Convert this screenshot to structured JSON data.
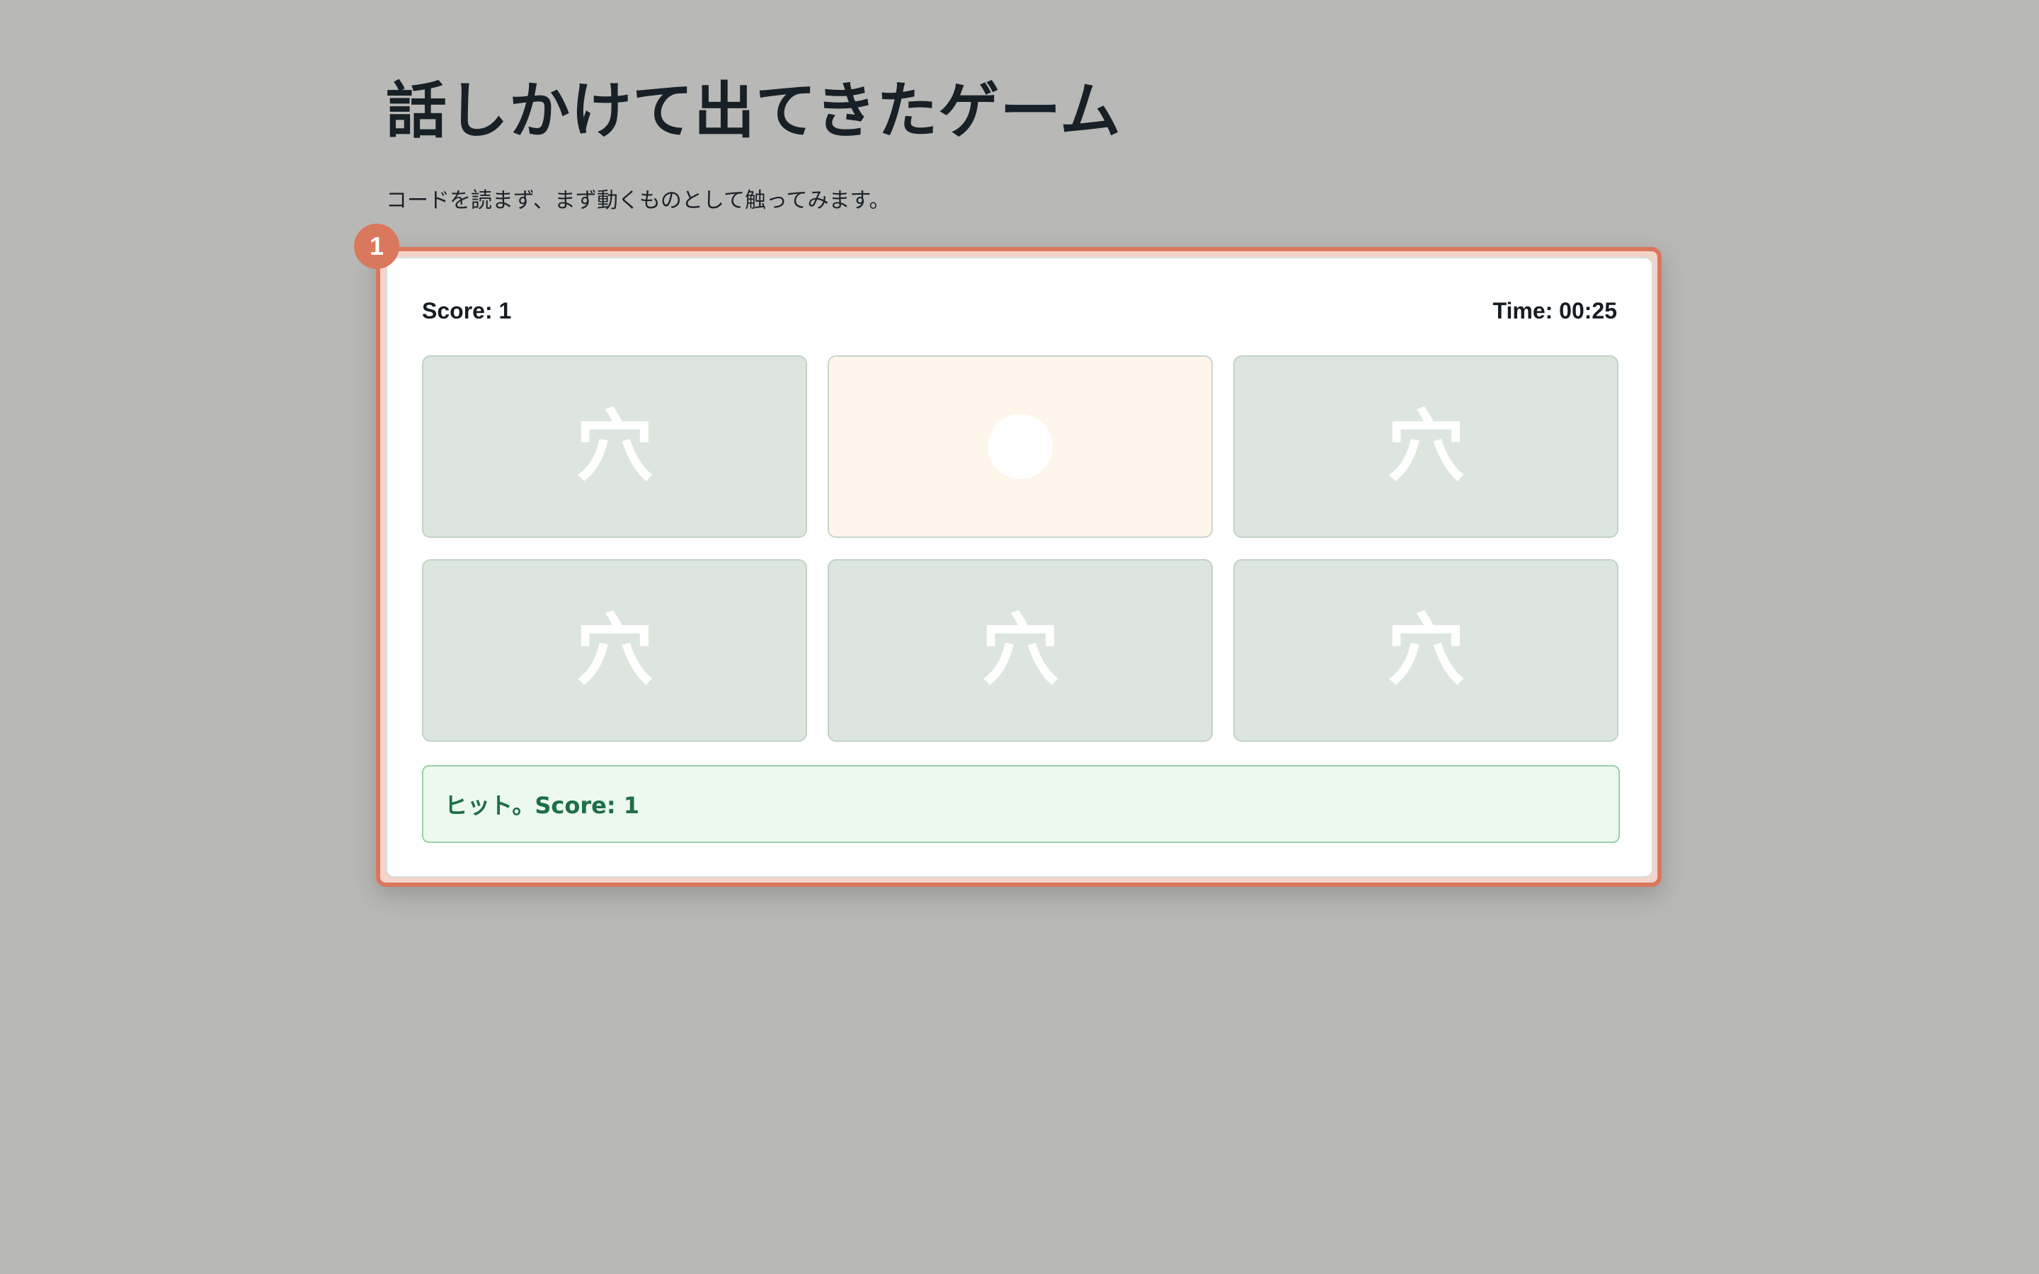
{
  "page": {
    "title": "話しかけて出てきたゲーム",
    "subtitle": "コードを読まず、まず動くものとして触ってみます。"
  },
  "annotation": {
    "badge": "1",
    "color": "#d9785c"
  },
  "game": {
    "score_text": "Score: 1",
    "time_text": "Time: 00:25",
    "holes": [
      {
        "label": "穴",
        "state": "empty"
      },
      {
        "label": "",
        "state": "mole"
      },
      {
        "label": "穴",
        "state": "empty"
      },
      {
        "label": "穴",
        "state": "empty"
      },
      {
        "label": "穴",
        "state": "empty"
      },
      {
        "label": "穴",
        "state": "empty"
      }
    ],
    "message": "ヒット。Score: 1",
    "colors": {
      "hole_empty": "#dce6de",
      "hole_active": "#fef5eb",
      "message_text": "#1d6f45",
      "message_bg": "#edf8ef"
    }
  }
}
